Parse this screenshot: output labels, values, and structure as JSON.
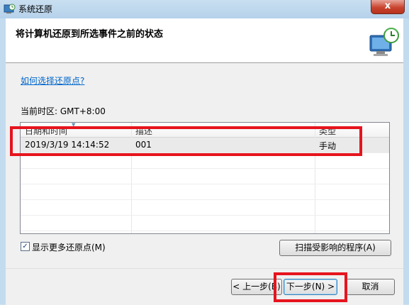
{
  "window": {
    "title": "系统还原",
    "close_label": "x",
    "header_title": "将计算机还原到所选事件之前的状态",
    "header_icon": "system-restore-monitor-icon"
  },
  "help_link": "如何选择还原点?",
  "timezone_label": "当前时区: GMT+8:00",
  "table": {
    "columns": [
      "日期和时间",
      "描述",
      "类型"
    ],
    "rows": [
      {
        "date": "2019/3/19 14:14:52",
        "description": "001",
        "type": "手动",
        "selected": true
      }
    ]
  },
  "show_more": {
    "label": "显示更多还原点(M)",
    "checked": true
  },
  "buttons": {
    "scan": "扫描受影响的程序(A)",
    "back": "< 上一步(B)",
    "next": "下一步(N) >",
    "cancel": "取消"
  },
  "colors": {
    "highlight": "#e6141e",
    "link": "#0066cc",
    "titlebar": "#c9dff1"
  }
}
